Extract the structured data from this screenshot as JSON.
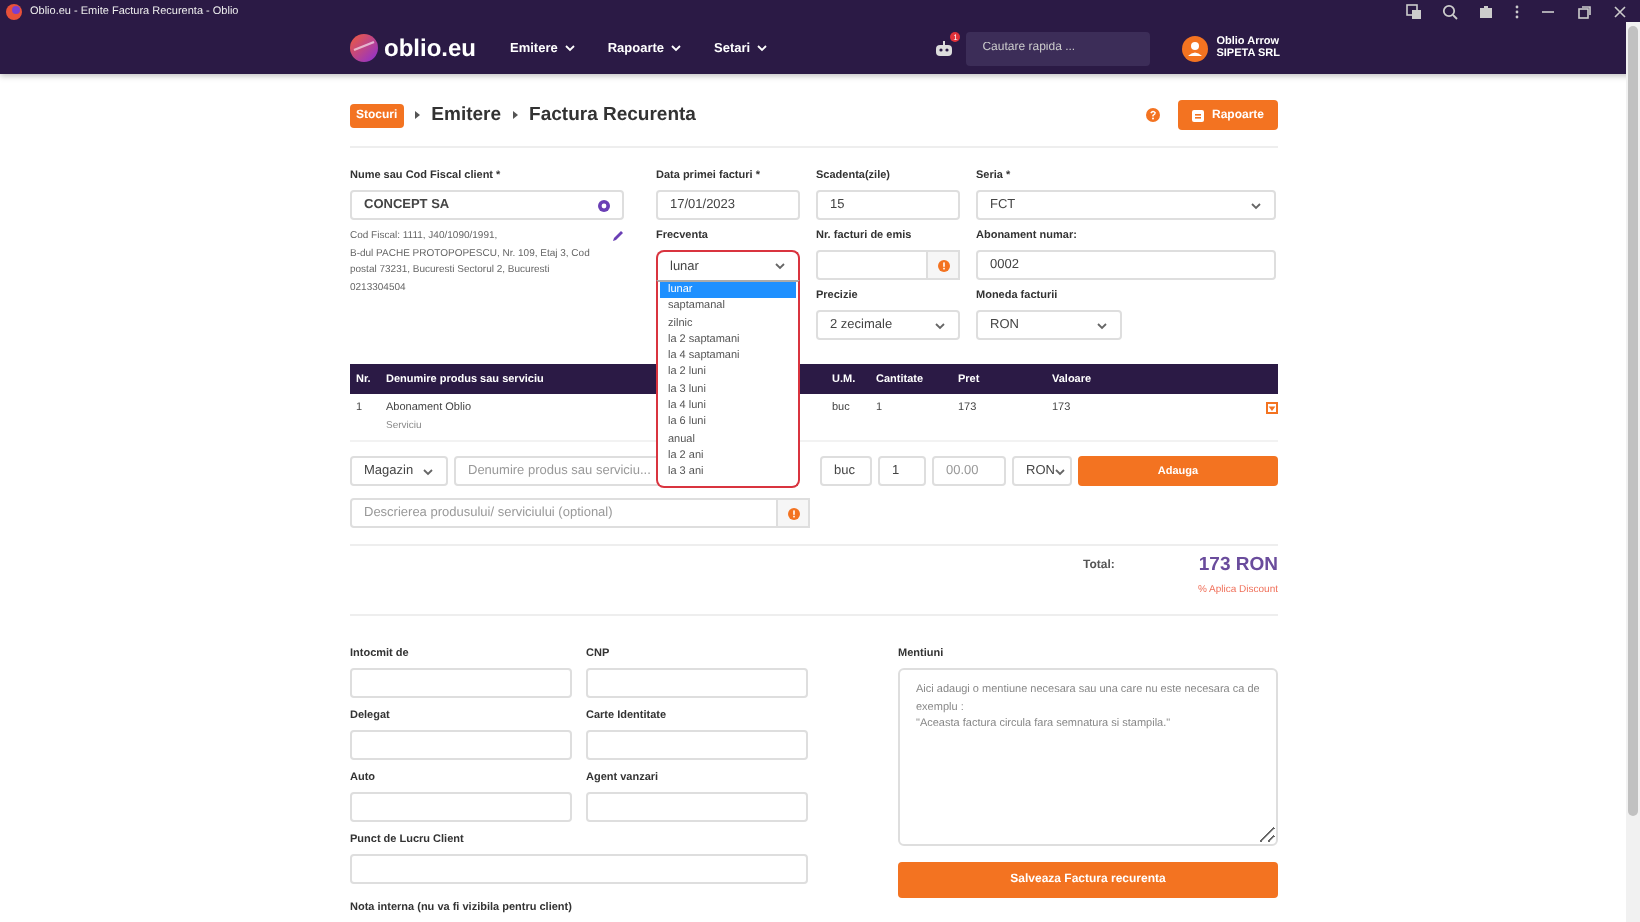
{
  "window": {
    "title": "Oblio.eu - Emite Factura Recurenta - Oblio"
  },
  "navbar": {
    "logo": "oblio.eu",
    "menu": [
      {
        "label": "Emitere"
      },
      {
        "label": "Rapoarte"
      },
      {
        "label": "Setari"
      }
    ],
    "notification_badge": "1",
    "search": {
      "placeholder": "Cautare rapida ..."
    },
    "user": {
      "name": "Oblio Arrow",
      "company": "SIPETA SRL"
    }
  },
  "breadcrumb": {
    "badge": "Stocuri",
    "items": [
      "Emitere",
      "Factura Recurenta"
    ]
  },
  "reports_button": "Rapoarte",
  "client": {
    "label": "Nume sau Cod Fiscal client *",
    "value": "CONCEPT SA",
    "details": [
      "Cod Fiscal: 1111, J40/1090/1991,",
      "B-dul PACHE PROTOPOPESCU, Nr. 109, Etaj 3, Cod postal 73231, Bucuresti Sectorul 2, Bucuresti",
      "0213304504"
    ]
  },
  "first_invoice_date": {
    "label": "Data primei facturi *",
    "value": "17/01/2023"
  },
  "due_days": {
    "label": "Scadenta(zile)",
    "value": "15"
  },
  "series": {
    "label": "Seria *",
    "value": "FCT"
  },
  "frequency": {
    "label": "Frecventa",
    "value": "lunar",
    "expanded": true,
    "options": [
      {
        "label": "lunar",
        "selected": true
      },
      {
        "label": "saptamanal",
        "selected": false
      },
      {
        "label": "zilnic",
        "selected": false
      },
      {
        "label": "la 2 saptamani",
        "selected": false
      },
      {
        "label": "la 4 saptamani",
        "selected": false
      },
      {
        "label": "la 2 luni",
        "selected": false
      },
      {
        "label": "la 3 luni",
        "selected": false
      },
      {
        "label": "la 4 luni",
        "selected": false
      },
      {
        "label": "la 6 luni",
        "selected": false
      },
      {
        "label": "anual",
        "selected": false
      },
      {
        "label": "la 2 ani",
        "selected": false
      },
      {
        "label": "la 3 ani",
        "selected": false
      }
    ]
  },
  "invoices_count": {
    "label": "Nr. facturi de emis"
  },
  "subscription_number": {
    "label": "Abonament numar:",
    "value": "0002"
  },
  "precision": {
    "label": "Precizie",
    "value": "2 zecimale"
  },
  "currency": {
    "label": "Moneda facturii",
    "value": "RON"
  },
  "table": {
    "columns": [
      "Nr.",
      "Denumire produs sau serviciu",
      "U.M.",
      "Cantitate",
      "Pret",
      "Valoare"
    ],
    "rows": [
      {
        "nr": "1",
        "name": "Abonament Oblio",
        "type": "Serviciu",
        "um": "buc",
        "quantity": "1",
        "price": "173",
        "value": "173"
      }
    ]
  },
  "add_product": {
    "store": "Magazin",
    "name_placeholder": "Denumire produs sau serviciu...",
    "um": "buc",
    "quantity": "1",
    "price_placeholder": "00.00",
    "currency": "RON",
    "button": "Adauga",
    "description_placeholder": "Descrierea produsului/ serviciului (optional)"
  },
  "totals": {
    "label": "Total:",
    "value": "173 RON",
    "discount_link": "% Aplica Discount"
  },
  "extra_fields": [
    {
      "label": "Intocmit de"
    },
    {
      "label": "CNP"
    },
    {
      "label": "Delegat"
    },
    {
      "label": "Carte Identitate"
    },
    {
      "label": "Auto"
    },
    {
      "label": "Agent vanzari"
    }
  ],
  "work_point": {
    "label": "Punct de Lucru Client"
  },
  "notes": {
    "label": "Mentiuni",
    "placeholder": "Aici adaugi o mentiune necesara sau una care nu este necesara ca de exemplu :\n\"Aceasta factura circula fara semnatura si stampila.\""
  },
  "save_button": "Salveaza Factura recurenta",
  "internal_note": {
    "label": "Nota interna (nu va fi vizibila pentru client)"
  }
}
